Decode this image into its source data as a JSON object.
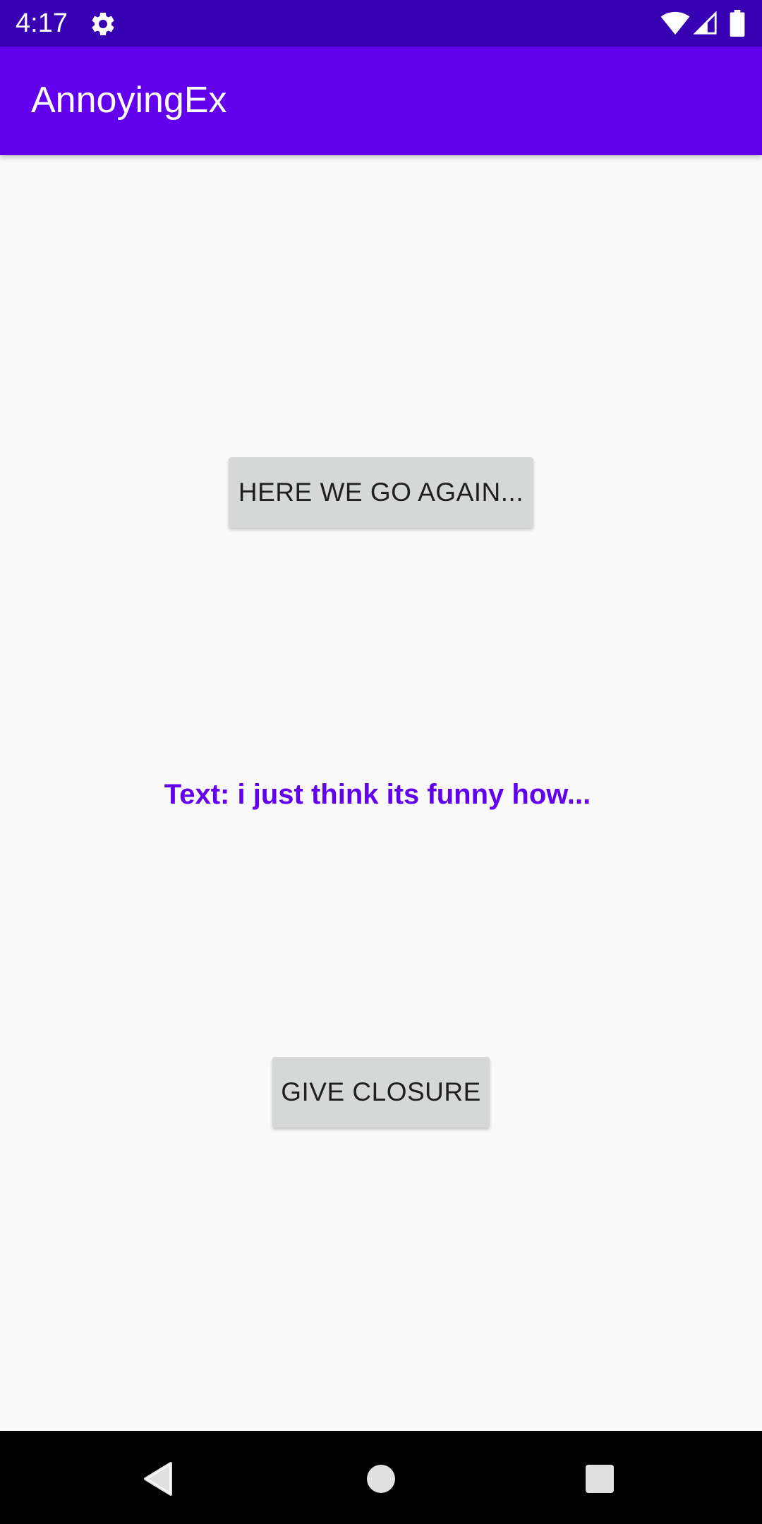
{
  "status_bar": {
    "time": "4:17",
    "icons": [
      "gear-icon",
      "wifi-icon",
      "cell-signal-icon",
      "battery-icon"
    ]
  },
  "app_bar": {
    "title": "AnnoyingEx",
    "color": "#6200ee"
  },
  "main": {
    "again_button_label": "HERE WE GO AGAIN...",
    "text_display": "Text: i just think its funny how...",
    "closure_button_label": "GIVE CLOSURE",
    "text_color": "#6200ee"
  },
  "nav_bar": {
    "icons": [
      "back-icon",
      "home-icon",
      "recents-icon"
    ]
  }
}
